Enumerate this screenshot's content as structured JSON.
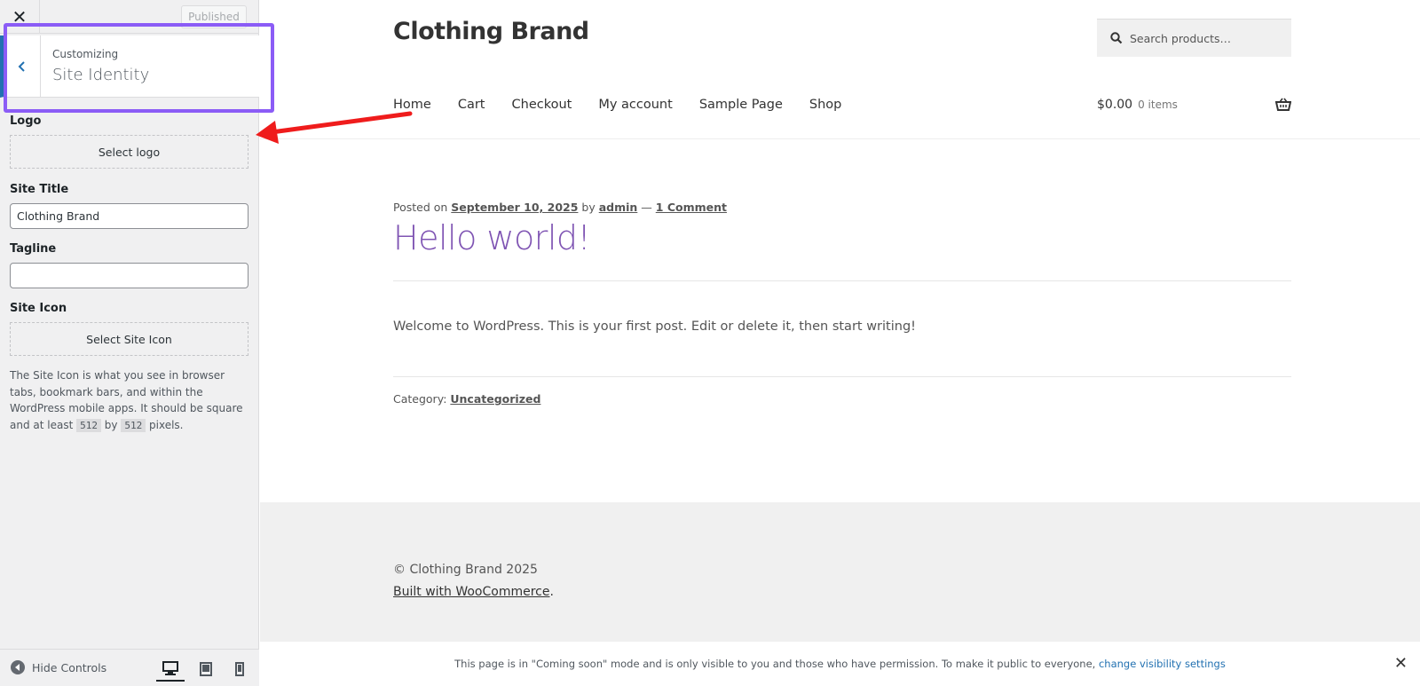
{
  "customizer": {
    "close_icon": "close-icon",
    "publish_label": "Published",
    "customizing_label": "Customizing",
    "section_title": "Site Identity",
    "logo_label": "Logo",
    "select_logo_label": "Select logo",
    "site_title_label": "Site Title",
    "site_title_value": "Clothing Brand",
    "tagline_label": "Tagline",
    "tagline_value": "",
    "site_icon_label": "Site Icon",
    "select_site_icon_label": "Select Site Icon",
    "icon_desc_1": "The Site Icon is what you see in browser tabs, bookmark bars, and within the WordPress mobile apps. It should be square and at least ",
    "icon_desc_code1": "512",
    "icon_desc_by": " by ",
    "icon_desc_code2": "512",
    "icon_desc_2": " pixels.",
    "hide_controls_label": "Hide Controls",
    "devices": [
      "desktop-icon",
      "tablet-icon",
      "mobile-icon"
    ]
  },
  "site": {
    "title": "Clothing Brand",
    "search_placeholder": "Search products…",
    "nav": [
      "Home",
      "Cart",
      "Checkout",
      "My account",
      "Sample Page",
      "Shop"
    ],
    "cart_amount": "$0.00",
    "cart_items": "0 items",
    "post": {
      "posted_on": "Posted on ",
      "date": "September 10, 2025",
      "by": " by ",
      "author": "admin",
      "dash": " — ",
      "comments": "1 Comment",
      "title": "Hello world!",
      "body": "Welcome to WordPress. This is your first post. Edit or delete it, then start writing!",
      "category_label": "Category: ",
      "category": "Uncategorized"
    },
    "footer": {
      "copyright": "© Clothing Brand 2025",
      "built_with": "Built with WooCommerce",
      "built_suffix": "."
    },
    "notice": {
      "text": "This page is in \"Coming soon\" mode and is only visible to you and those who have permission. To make it public to everyone, ",
      "link": "change visibility settings"
    }
  },
  "colors": {
    "highlight": "#8b5cf6",
    "arrow": "#ef1c1c",
    "post_title": "#7f54b3",
    "link_blue": "#2271b1"
  }
}
